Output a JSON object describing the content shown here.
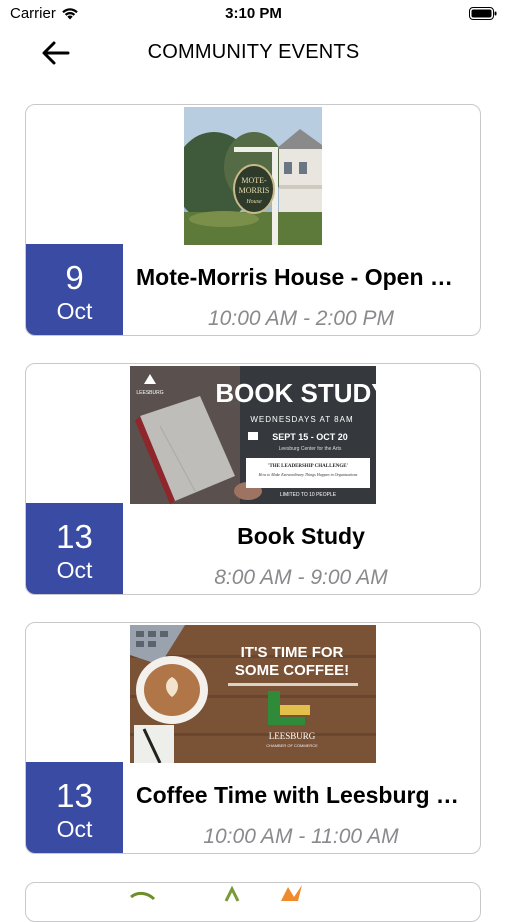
{
  "status_bar": {
    "carrier": "Carrier",
    "time": "3:10 PM"
  },
  "header": {
    "title": "COMMUNITY EVENTS",
    "back_icon": "arrow-left-icon"
  },
  "events": [
    {
      "day": "9",
      "month": "Oct",
      "title": "Mote-Morris House - Open House",
      "time": "10:00 AM - 2:00 PM",
      "image": {
        "sign_line1": "MOTE-",
        "sign_line2": "MORRIS",
        "sign_line3": "House"
      }
    },
    {
      "day": "13",
      "month": "Oct",
      "title": "Book Study",
      "time": "8:00 AM - 9:00 AM",
      "image": {
        "heading": "BOOK STUDY",
        "schedule": "WEDNESDAYS AT 8AM",
        "dates": "SEPT 15 - OCT 20",
        "venue": "Leesburg Center for the Arts",
        "book_title": "'THE LEADERSHIP CHALLENGE'",
        "book_subtitle": "How to Make Extraordinary Things Happen in Organizations",
        "limit": "LIMITED TO 10 PEOPLE",
        "logo_text": "LEESBURG"
      }
    },
    {
      "day": "13",
      "month": "Oct",
      "title": "Coffee Time with Leesburg Chamber",
      "time": "10:00 AM - 11:00 AM",
      "image": {
        "line1": "IT'S TIME FOR",
        "line2": "SOME COFFEE!",
        "logo_text": "LEESBURG",
        "logo_sub": "CHAMBER OF COMMERCE"
      }
    }
  ],
  "colors": {
    "date_block": "#3a4ba4",
    "time_text": "#8a8a8e",
    "card_border": "#c9c9cc"
  }
}
